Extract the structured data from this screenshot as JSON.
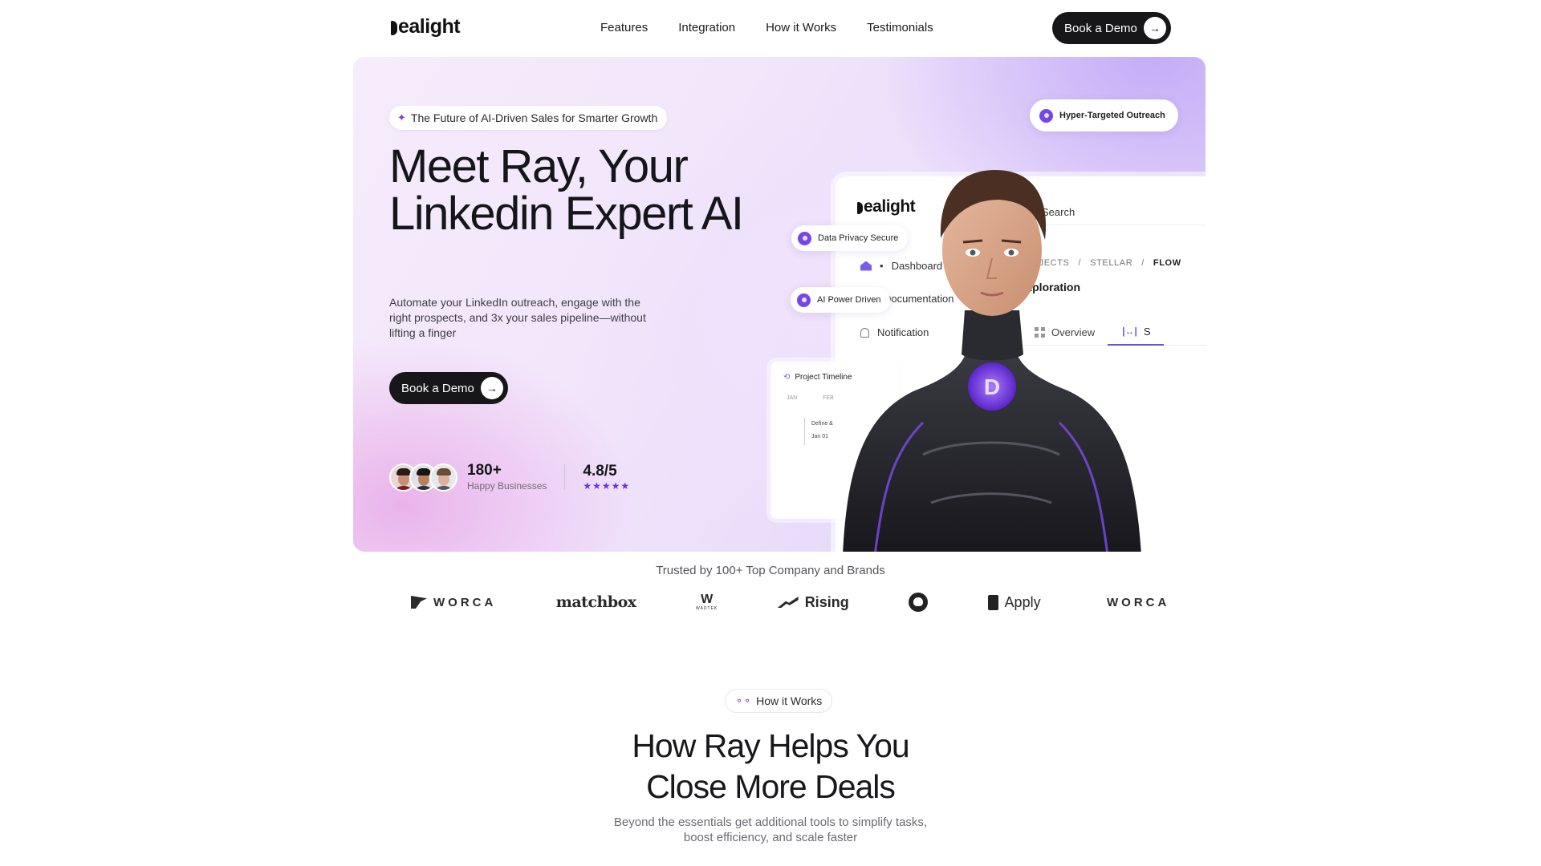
{
  "nav": {
    "logo": "ealight",
    "links": [
      "Features",
      "Integration",
      "How it Works",
      "Testimonials"
    ],
    "cta": "Book a Demo"
  },
  "hero": {
    "tag": "The Future of AI-Driven Sales for Smarter Growth",
    "title": "Meet Ray, Your Linkedin Expert AI",
    "subtitle": "Automate your LinkedIn outreach, engage with the right prospects, and 3x your sales pipeline—without lifting a finger",
    "cta": "Book a Demo",
    "stats": {
      "businesses_count": "180+",
      "businesses_label": "Happy Businesses",
      "rating": "4.8/5",
      "stars": "★★★★★"
    },
    "badges": {
      "targeted": "Hyper-Targeted Outreach",
      "privacy": "Data Privacy Secure",
      "power": "AI Power Driven"
    },
    "dashboard": {
      "logo": "ealight",
      "search": "Search",
      "nav": [
        "Dashboard",
        "Documentation",
        "Notification"
      ],
      "breadcrumb": [
        "PROJECTS",
        "/",
        "STELLAR",
        "/",
        "FLOW"
      ],
      "heading": "Exploration",
      "tabs": [
        "Overview",
        "S"
      ],
      "timeline": {
        "title": "Project Timeline",
        "months": [
          "JAN",
          "FEB"
        ],
        "item": "Define &",
        "date": "Jan 01"
      }
    },
    "accent_color": "#7546e6"
  },
  "trusted": {
    "label": "Trusted by 100+ Top Company and Brands",
    "brands": [
      "WORCA",
      "matchbox",
      "WADTEK",
      "Rising",
      "GitHub",
      "Apply",
      "WORCA"
    ]
  },
  "how": {
    "pill": "How it Works",
    "title_line1": "How Ray Helps You",
    "title_line2": "Close More Deals",
    "subtitle": "Beyond the essentials get additional tools to simplify tasks, boost efficiency, and scale faster"
  }
}
